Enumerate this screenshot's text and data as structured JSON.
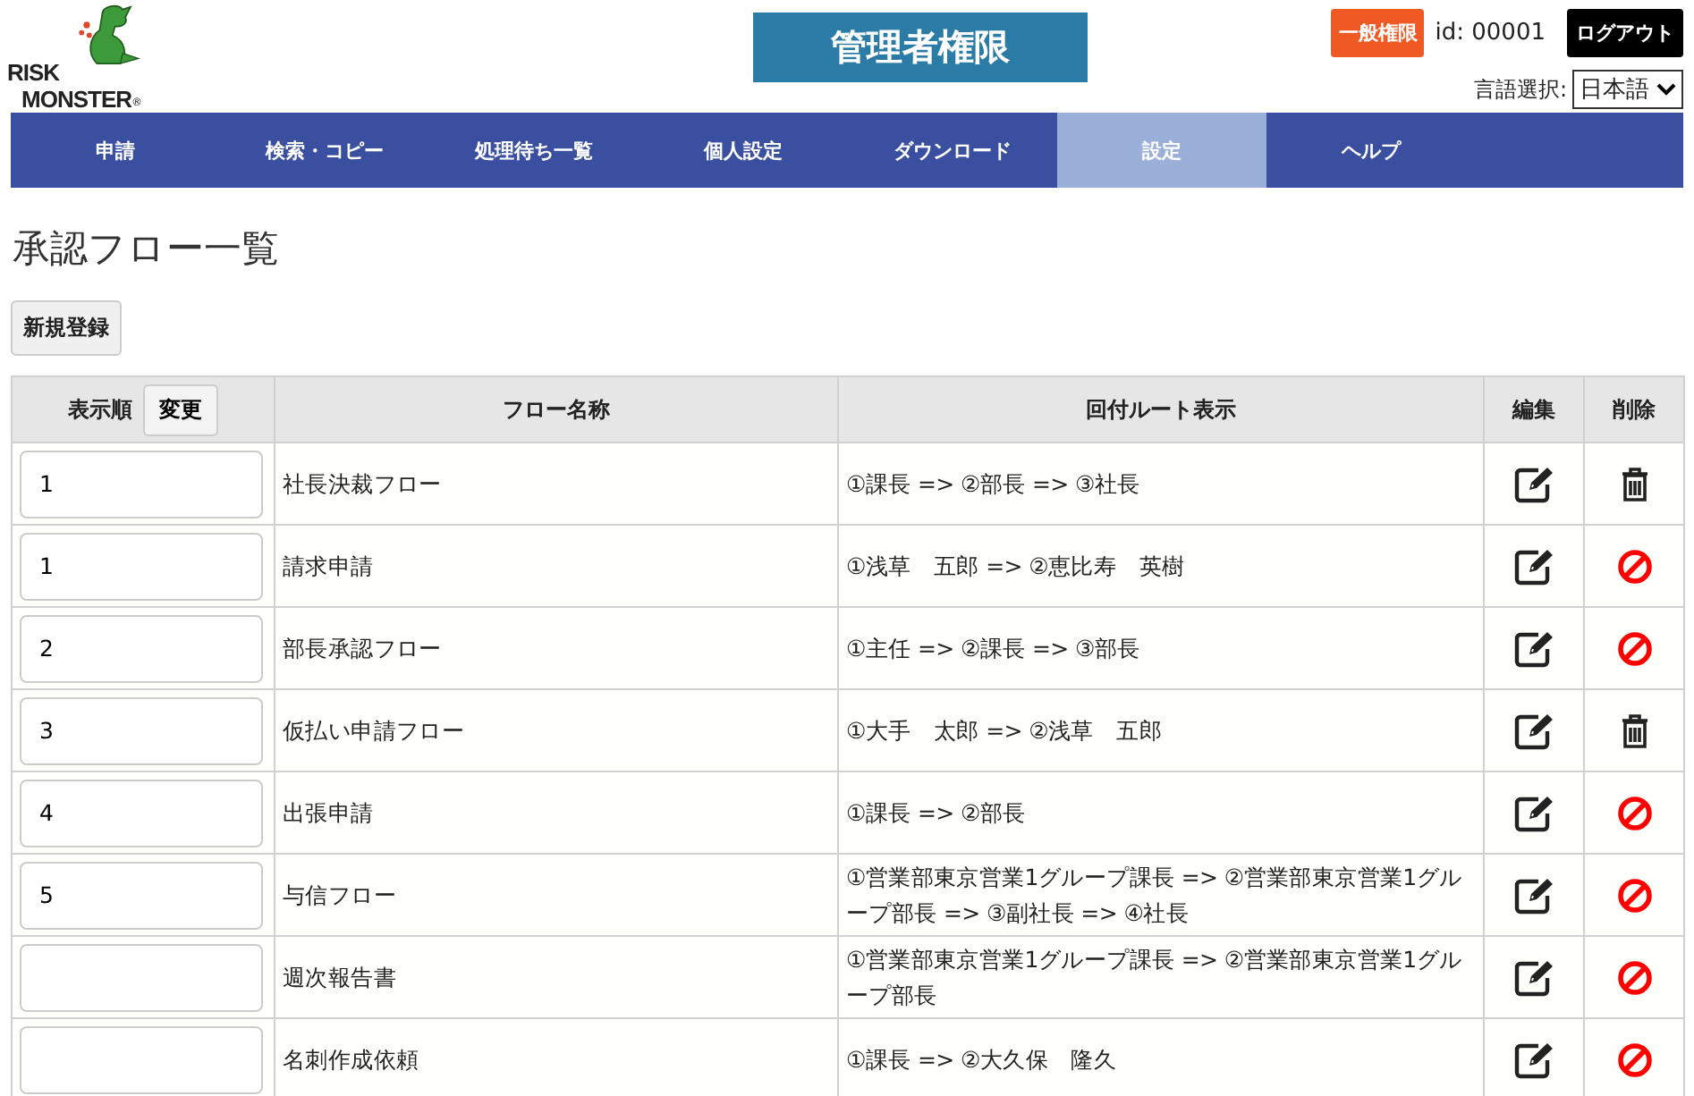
{
  "logo": {
    "line_1": "RISK",
    "line_2": "MONSTER",
    "mark": "®"
  },
  "role_banner": "管理者権限",
  "header": {
    "role_badge": "一般権限",
    "user_id": "id: 00001",
    "logout": "ログアウト",
    "language_label": "言語選択:",
    "language_value": "日本語"
  },
  "nav": [
    {
      "label": "申請",
      "selected": false
    },
    {
      "label": "検索・コピー",
      "selected": false
    },
    {
      "label": "処理待ち一覧",
      "selected": false
    },
    {
      "label": "個人設定",
      "selected": false
    },
    {
      "label": "ダウンロード",
      "selected": false
    },
    {
      "label": "設定",
      "selected": true
    },
    {
      "label": "ヘルプ",
      "selected": false
    }
  ],
  "page_title": "承認フロー一覧",
  "new_button": "新規登録",
  "table": {
    "columns": [
      "表示順",
      "フロー名称",
      "回付ルート表示",
      "編集",
      "削除"
    ],
    "change_button": "変更",
    "rows": [
      {
        "order": "1",
        "name": "社長決裁フロー",
        "route": "①課長 => ②部長 => ③社長",
        "deletable": true
      },
      {
        "order": "1",
        "name": "請求申請",
        "route": "①浅草　五郎 => ②恵比寿　英樹",
        "deletable": false
      },
      {
        "order": "2",
        "name": "部長承認フロー",
        "route": "①主任 => ②課長 => ③部長",
        "deletable": false
      },
      {
        "order": "3",
        "name": "仮払い申請フロー",
        "route": "①大手　太郎 => ②浅草　五郎",
        "deletable": true
      },
      {
        "order": "4",
        "name": "出張申請",
        "route": "①課長 => ②部長",
        "deletable": false
      },
      {
        "order": "5",
        "name": "与信フロー",
        "route": "①営業部東京営業1グループ課長 => ②営業部東京営業1グループ部長 => ③副社長 => ④社長",
        "deletable": false
      },
      {
        "name": "週次報告書",
        "route": "①営業部東京営業1グループ課長 => ②営業部東京営業1グループ部長",
        "deletable": false
      },
      {
        "name": "名刺作成依頼",
        "route": "①課長 => ②大久保　隆久",
        "deletable": false
      }
    ]
  }
}
